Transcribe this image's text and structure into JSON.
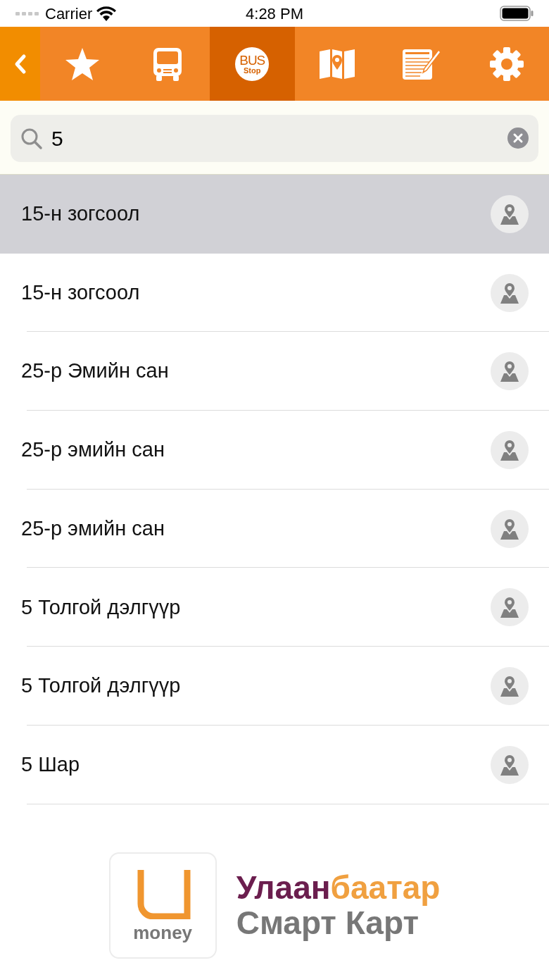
{
  "status_bar": {
    "carrier": "Carrier",
    "time": "4:28 PM"
  },
  "tabs": [
    {
      "kind": "favorites",
      "selected": false
    },
    {
      "kind": "bus",
      "selected": false
    },
    {
      "kind": "stop",
      "selected": true,
      "label_top": "BUS",
      "label_bottom": "Stop"
    },
    {
      "kind": "map",
      "selected": false
    },
    {
      "kind": "notes",
      "selected": false
    },
    {
      "kind": "settings",
      "selected": false
    }
  ],
  "search": {
    "value": "5"
  },
  "stops": [
    {
      "name": "15-н зогсоол",
      "selected": true
    },
    {
      "name": "15-н зогсоол",
      "selected": false
    },
    {
      "name": "25-р Эмийн сан",
      "selected": false
    },
    {
      "name": "25-р эмийн сан",
      "selected": false
    },
    {
      "name": "25-р эмийн сан",
      "selected": false
    },
    {
      "name": "5 Толгой дэлгүүр",
      "selected": false
    },
    {
      "name": "5 Толгой дэлгүүр",
      "selected": false
    },
    {
      "name": "5 Шар",
      "selected": false
    }
  ],
  "banner": {
    "logo_word": "money",
    "title_first": "Улаан",
    "title_second": "баатар",
    "subtitle": "Смарт Карт"
  }
}
